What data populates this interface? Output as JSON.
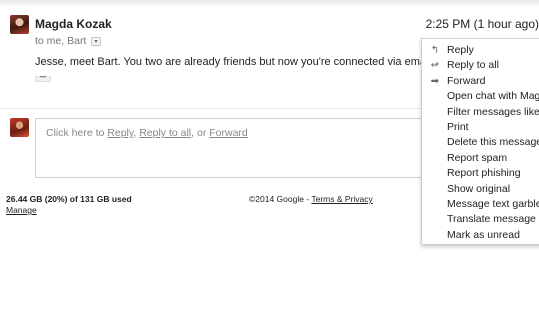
{
  "message": {
    "sender": "Magda Kozak",
    "timestamp": "2:25 PM (1 hour ago)",
    "recipients": "to me, Bart",
    "body": "Jesse, meet Bart. You two are already friends but now you're connected via email!",
    "ellipsis": "•••"
  },
  "reply": {
    "prefix": "Click here to ",
    "reply_label": "Reply",
    "sep1": ", ",
    "reply_all_label": "Reply to all",
    "sep2": ", or ",
    "forward_label": "Forward"
  },
  "footer": {
    "storage": "26.44 GB (20%) of 131 GB used",
    "manage": "Manage",
    "copyright": "©2014 Google - ",
    "terms": "Terms & Privacy"
  },
  "menu": {
    "items": [
      {
        "label": "Reply",
        "icon": "reply-icon",
        "glyph": "↰"
      },
      {
        "label": "Reply to all",
        "icon": "reply-all-icon",
        "glyph": "↫"
      },
      {
        "label": "Forward",
        "icon": "forward-icon",
        "glyph": "➡"
      },
      {
        "label": "Open chat with Mag",
        "icon": "",
        "glyph": ""
      },
      {
        "label": "Filter messages like",
        "icon": "",
        "glyph": ""
      },
      {
        "label": "Print",
        "icon": "",
        "glyph": ""
      },
      {
        "label": "Delete this message",
        "icon": "",
        "glyph": ""
      },
      {
        "label": "Report spam",
        "icon": "",
        "glyph": ""
      },
      {
        "label": "Report phishing",
        "icon": "",
        "glyph": ""
      },
      {
        "label": "Show original",
        "icon": "",
        "glyph": ""
      },
      {
        "label": "Message text garble",
        "icon": "",
        "glyph": ""
      },
      {
        "label": "Translate message",
        "icon": "",
        "glyph": ""
      },
      {
        "label": "Mark as unread",
        "icon": "",
        "glyph": ""
      }
    ]
  }
}
